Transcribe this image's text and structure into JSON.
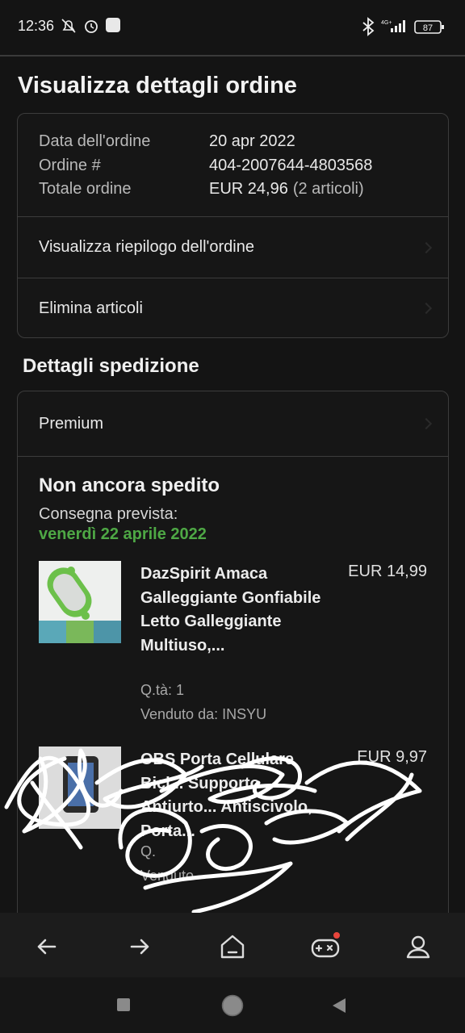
{
  "status_bar": {
    "time": "12:36",
    "network": "4G+",
    "battery": "87"
  },
  "page": {
    "title": "Visualizza dettagli ordine"
  },
  "order": {
    "date_label": "Data dell'ordine",
    "date_value": "20 apr 2022",
    "number_label": "Ordine #",
    "number_value": "404-2007644-4803568",
    "total_label": "Totale ordine",
    "total_value": "EUR 24,96",
    "total_items": "(2 articoli)"
  },
  "links": {
    "summary": "Visualizza riepilogo dell'ordine",
    "delete": "Elimina articoli"
  },
  "shipping": {
    "section_title": "Dettagli spedizione",
    "method": "Premium",
    "status": "Non ancora spedito",
    "eta_label": "Consegna prevista:",
    "eta_date": "venerdì 22 aprile 2022"
  },
  "items": [
    {
      "title": "DazSpirit Amaca Galleggiante Gonfiabile Letto Galleggiante Multiuso,...",
      "price": "EUR 14,99",
      "qty": "Q.tà: 1",
      "seller": "Venduto da: INSYU"
    },
    {
      "title": "OBS Porta Cellulare Bici... Supporto Antiurto... Antiscivolo, Porta...",
      "price": "EUR 9,97",
      "qty": "Q.",
      "seller": "Venduto"
    }
  ],
  "colors": {
    "background": "#141414",
    "accent_green": "#4ea845",
    "border": "#3c3c3c"
  },
  "icons": [
    "back-arrow-icon",
    "forward-arrow-icon",
    "home-icon",
    "game-controller-icon",
    "profile-icon",
    "recent-apps-icon",
    "home-circle-icon",
    "back-triangle-icon"
  ]
}
